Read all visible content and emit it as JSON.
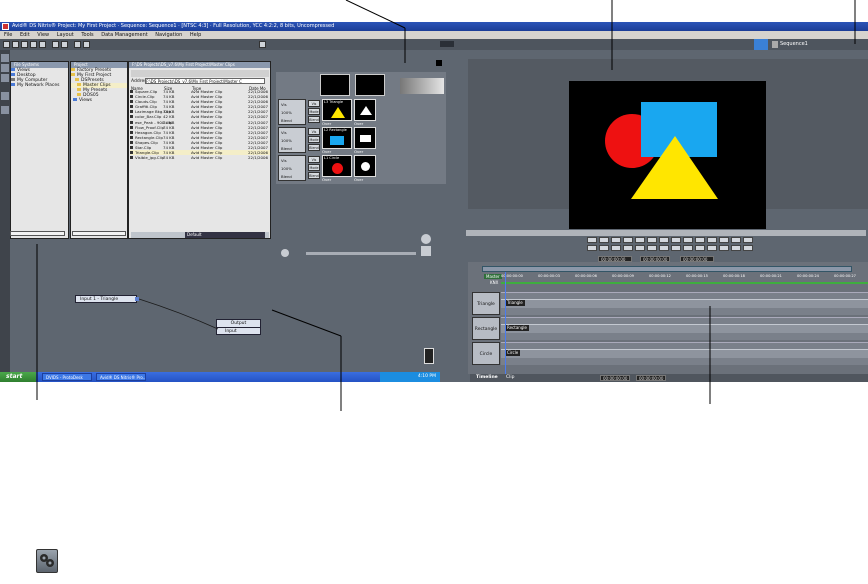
{
  "window": {
    "title": "Avid® DS Nitris® Project: My First Project · Sequence: Sequence1 · [NTSC 4:3] · Full Resolution, YCC 4:2:2, 8 bits, Uncompressed"
  },
  "menu": [
    "File",
    "Edit",
    "View",
    "Layout",
    "Tools",
    "Data Management",
    "Navigation",
    "Help"
  ],
  "file_system": {
    "title": "File Systems",
    "items": [
      "Views",
      "Desktop",
      "My Computer",
      "My Network Places"
    ]
  },
  "project": {
    "title": "Project",
    "items": [
      "Factory Presets",
      "My First Project",
      "DSPresets",
      "Master Clips",
      "My Presets",
      "DOS05",
      "Views"
    ]
  },
  "bin": {
    "title": "F:\\DS Projects\\DS_v7.6\\My First Project\\Master Clips",
    "address_label": "Address",
    "address_value": "F:\\DS Projects\\DS_v7.6\\My First Project\\Master C",
    "columns": [
      "Name",
      "Size",
      "Type",
      "Date Mo"
    ],
    "rows": [
      {
        "name": "Square.Clip",
        "size": "74 KB",
        "type": "Avid Master Clip",
        "date": "22/1/2006"
      },
      {
        "name": "Circle.Clip",
        "size": "74 KB",
        "type": "Avid Master Clip",
        "date": "22/1/2006"
      },
      {
        "name": "Clouds.Clip",
        "size": "74 KB",
        "type": "Avid Master Clip",
        "date": "22/1/2006"
      },
      {
        "name": "Graffiti.Clip",
        "size": "74 KB",
        "type": "Avid Master Clip",
        "date": "22/1/2007"
      },
      {
        "name": "Lazimage Bkg.Clip",
        "size": "74 KB",
        "type": "Avid Master Clip",
        "date": "22/1/2007"
      },
      {
        "name": "color_Bar.Clip",
        "size": "42 KB",
        "type": "Avid Master Clip",
        "date": "22/1/2007"
      },
      {
        "name": "ese_Peak - 900.clip",
        "size": "74 KB",
        "type": "Avid Master Clip",
        "date": "22/1/2007"
      },
      {
        "name": "Flow_Proof.Clip",
        "size": "74 KB",
        "type": "Avid Master Clip",
        "date": "22/1/2007"
      },
      {
        "name": "Hexagon.Clip",
        "size": "74 KB",
        "type": "Avid Master Clip",
        "date": "22/1/2007"
      },
      {
        "name": "Rectangle.Clip",
        "size": "74 KB",
        "type": "Avid Master Clip",
        "date": "22/1/2007"
      },
      {
        "name": "Shapes.Clip",
        "size": "74 KB",
        "type": "Avid Master Clip",
        "date": "22/1/2007"
      },
      {
        "name": "Star.Clip",
        "size": "74 KB",
        "type": "Avid Master Clip",
        "date": "22/1/2007"
      },
      {
        "name": "Triangle.Clip",
        "size": "74 KB",
        "type": "Avid Master Clip",
        "date": "22/1/2006"
      },
      {
        "name": "Visible_jpg.Clip",
        "size": "74 KB",
        "type": "Avid Master Clip",
        "date": "22/1/2006"
      }
    ],
    "footer_field": "Default"
  },
  "layers": [
    {
      "label": "L3 Triangle",
      "mode": "Over"
    },
    {
      "label": "L2 Rectangle",
      "mode": "Over"
    },
    {
      "label": "L1 Circle",
      "mode": "Over"
    }
  ],
  "layer_controls": {
    "vis": "Vis",
    "mode": "Mode",
    "opacity": "100%",
    "blend": "Blend"
  },
  "monitor": {
    "sequence_label": "Sequence1",
    "timecode_in": "00:00:00:00",
    "timecode_out": "00:00:00:00",
    "timecode_current": "00:00:00:00"
  },
  "timeline": {
    "header": [
      "Master",
      "KNX"
    ],
    "ruler": [
      "00:00:00:00",
      "00:00:00:03",
      "00:00:00:06",
      "00:00:00:09",
      "00:00:00:12",
      "00:00:00:15",
      "00:00:00:18",
      "00:00:00:21",
      "00:00:00:24",
      "00:00:00:27"
    ],
    "tracks": [
      {
        "name": "Triangle",
        "clip": "Triangle"
      },
      {
        "name": "Rectangle",
        "clip": "Rectangle"
      },
      {
        "name": "Circle",
        "clip": "Circle"
      }
    ],
    "footer_label": "Timeline",
    "footer_field": "Clip",
    "footer_tc1": "00:00:00:00",
    "footer_tc2": "00:00:00:00"
  },
  "graph": {
    "input_node": "Input 1 - Triangle",
    "output_node": "Output",
    "output_port": "Input"
  },
  "taskbar": {
    "start": "start",
    "items": [
      "DVIDS - ProtoDesk",
      "Avid® DS Nitris® Pro..."
    ],
    "clock": "4:10 PM"
  },
  "colors": {
    "red": "#ee1111",
    "blue": "#19a7f0",
    "yellow": "#ffe600"
  }
}
